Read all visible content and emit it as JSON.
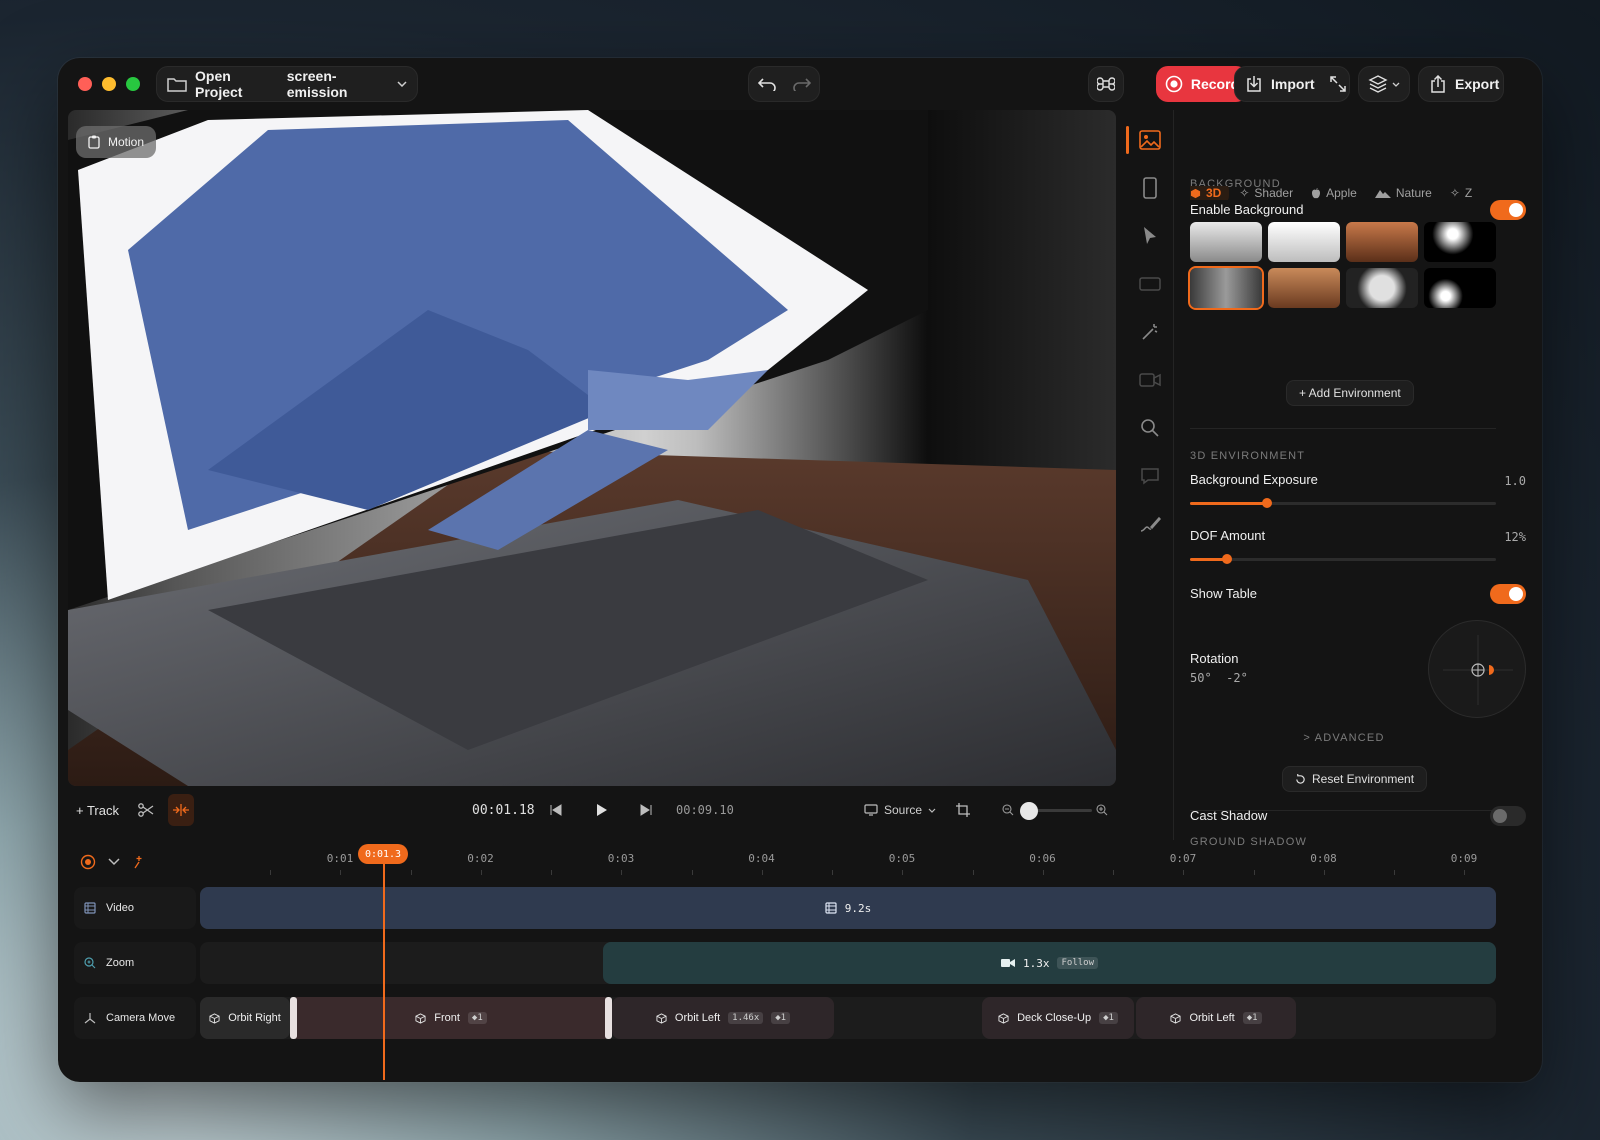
{
  "window": {
    "open_project_label": "Open Project",
    "project_name": "screen-emission",
    "record_label": "Record",
    "import_label": "Import",
    "export_label": "Export"
  },
  "canvas": {
    "motion_badge": "Motion"
  },
  "panel": {
    "background_section": "BACKGROUND",
    "enable_background": "Enable Background",
    "enable_background_on": true,
    "tabs": [
      {
        "label": "3D",
        "icon": "cube-icon",
        "active": true
      },
      {
        "label": "Shader",
        "icon": "sparkle-icon",
        "active": false
      },
      {
        "label": "Apple",
        "icon": "apple-icon",
        "active": false
      },
      {
        "label": "Nature",
        "icon": "mountain-icon",
        "active": false
      },
      {
        "label": "Z",
        "icon": "sparkle-icon",
        "active": false
      }
    ],
    "add_environment": "+ Add Environment",
    "env3d_section": "3D ENVIRONMENT",
    "bg_exposure_label": "Background Exposure",
    "bg_exposure_value": "1.0",
    "bg_exposure_fraction": 0.25,
    "dof_label": "DOF Amount",
    "dof_value": "12%",
    "dof_fraction": 0.12,
    "show_table_label": "Show Table",
    "show_table_on": true,
    "rotation_label": "Rotation",
    "rotation_value": "50°  -2°",
    "advanced_label": "> ADVANCED",
    "reset_environment": "Reset Environment",
    "ground_shadow_section": "GROUND SHADOW",
    "cast_shadow_label": "Cast Shadow",
    "cast_shadow_on": false
  },
  "transport": {
    "track_label": "+ Track",
    "current_time": "00:01.18",
    "total_time": "00:09.10",
    "source_label": "Source",
    "zoom_fraction": 0.0
  },
  "timeline": {
    "ticks": [
      "0:01",
      "0:02",
      "0:03",
      "0:04",
      "0:05",
      "0:06",
      "0:07",
      "0:08",
      "0:09"
    ],
    "playhead_label": "0:01.3",
    "tracks": {
      "video": {
        "label": "Video",
        "clip_label": "9.2s"
      },
      "zoom": {
        "label": "Zoom",
        "clip_label": "1.3x",
        "clip_tag": "Follow"
      },
      "camera": {
        "label": "Camera Move",
        "clips": [
          {
            "label": "Orbit Right"
          },
          {
            "label": "Front",
            "tag": "◆1"
          },
          {
            "label": "Orbit Left",
            "speed": "1.46x",
            "tag": "◆1"
          },
          {
            "label": "Deck Close-Up",
            "tag": "◆1"
          },
          {
            "label": "Orbit Left",
            "tag": "◆1"
          }
        ]
      }
    }
  },
  "colors": {
    "accent": "#f06a1c",
    "record": "#e8363f",
    "video_clip": "#2f3a4f",
    "zoom_clip": "#243d40",
    "camera_clip": "#3a2a2c"
  }
}
